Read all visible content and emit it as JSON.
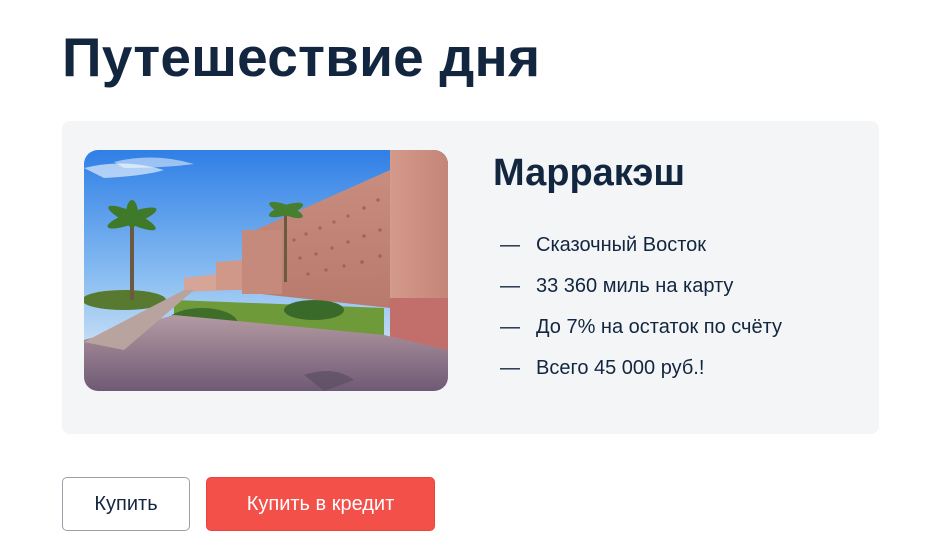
{
  "page": {
    "title": "Путешествие дня"
  },
  "offer": {
    "city": "Марракэш",
    "image_subject": "Marrakech city walls",
    "features": [
      "Сказочный Восток",
      "33 360 миль на карту",
      "До 7% на остаток по счёту",
      "Всего 45 000 руб.!"
    ],
    "bullet": "—"
  },
  "actions": {
    "buy_label": "Купить",
    "credit_label": "Купить в кредит"
  },
  "colors": {
    "text": "#13263f",
    "card_background": "#f4f5f7",
    "accent": "#f25049"
  }
}
